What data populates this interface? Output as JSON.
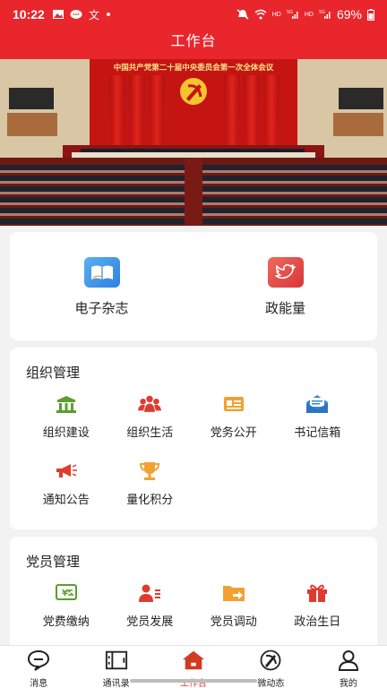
{
  "status_bar": {
    "time": "10:22",
    "battery": "69%",
    "network_labels": [
      "HD",
      "5G",
      "HD",
      "5G"
    ]
  },
  "header": {
    "title": "工作台"
  },
  "banner": {
    "caption": "中国共产党第二十届中央委员会第一次全体会议"
  },
  "featured": [
    {
      "label": "电子杂志",
      "icon": "book-icon"
    },
    {
      "label": "政能量",
      "icon": "bird-icon"
    }
  ],
  "org_section": {
    "title": "组织管理",
    "items": [
      {
        "label": "组织建设",
        "icon": "building-icon"
      },
      {
        "label": "组织生活",
        "icon": "group-icon"
      },
      {
        "label": "党务公开",
        "icon": "id-card-icon"
      },
      {
        "label": "书记信箱",
        "icon": "mailbox-icon"
      },
      {
        "label": "通知公告",
        "icon": "megaphone-icon"
      },
      {
        "label": "量化积分",
        "icon": "trophy-icon"
      }
    ]
  },
  "member_section": {
    "title": "党员管理",
    "items": [
      {
        "label": "党费缴纳",
        "icon": "fee-icon"
      },
      {
        "label": "党员发展",
        "icon": "member-growth-icon"
      },
      {
        "label": "党员调动",
        "icon": "folder-transfer-icon"
      },
      {
        "label": "政治生日",
        "icon": "gift-icon"
      }
    ]
  },
  "tabs": [
    {
      "label": "消息",
      "icon": "chat-icon",
      "active": false
    },
    {
      "label": "通讯录",
      "icon": "contacts-icon",
      "active": false
    },
    {
      "label": "工作台",
      "icon": "home-icon",
      "active": true
    },
    {
      "label": "微动态",
      "icon": "party-emblem-icon",
      "active": false
    },
    {
      "label": "我的",
      "icon": "person-icon",
      "active": false
    }
  ],
  "colors": {
    "primary_red": "#e8262c",
    "active_tab": "#d43a1f",
    "icon_green": "#5a9e2f",
    "icon_red": "#e03b2f",
    "icon_orange": "#f0a132",
    "icon_blue": "#3a86d6"
  }
}
